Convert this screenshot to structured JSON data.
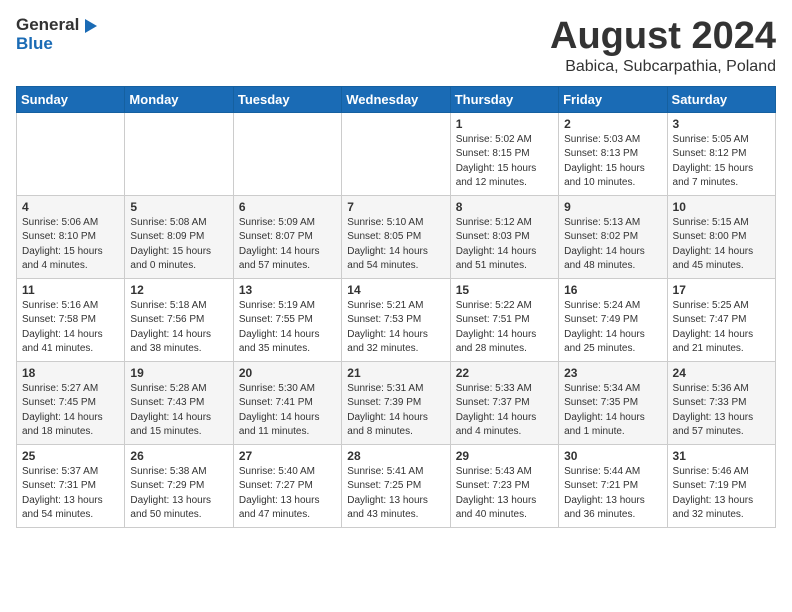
{
  "header": {
    "logo_general": "General",
    "logo_blue": "Blue",
    "main_title": "August 2024",
    "subtitle": "Babica, Subcarpathia, Poland"
  },
  "calendar": {
    "days_of_week": [
      "Sunday",
      "Monday",
      "Tuesday",
      "Wednesday",
      "Thursday",
      "Friday",
      "Saturday"
    ],
    "weeks": [
      [
        {
          "day": "",
          "info": ""
        },
        {
          "day": "",
          "info": ""
        },
        {
          "day": "",
          "info": ""
        },
        {
          "day": "",
          "info": ""
        },
        {
          "day": "1",
          "info": "Sunrise: 5:02 AM\nSunset: 8:15 PM\nDaylight: 15 hours\nand 12 minutes."
        },
        {
          "day": "2",
          "info": "Sunrise: 5:03 AM\nSunset: 8:13 PM\nDaylight: 15 hours\nand 10 minutes."
        },
        {
          "day": "3",
          "info": "Sunrise: 5:05 AM\nSunset: 8:12 PM\nDaylight: 15 hours\nand 7 minutes."
        }
      ],
      [
        {
          "day": "4",
          "info": "Sunrise: 5:06 AM\nSunset: 8:10 PM\nDaylight: 15 hours\nand 4 minutes."
        },
        {
          "day": "5",
          "info": "Sunrise: 5:08 AM\nSunset: 8:09 PM\nDaylight: 15 hours\nand 0 minutes."
        },
        {
          "day": "6",
          "info": "Sunrise: 5:09 AM\nSunset: 8:07 PM\nDaylight: 14 hours\nand 57 minutes."
        },
        {
          "day": "7",
          "info": "Sunrise: 5:10 AM\nSunset: 8:05 PM\nDaylight: 14 hours\nand 54 minutes."
        },
        {
          "day": "8",
          "info": "Sunrise: 5:12 AM\nSunset: 8:03 PM\nDaylight: 14 hours\nand 51 minutes."
        },
        {
          "day": "9",
          "info": "Sunrise: 5:13 AM\nSunset: 8:02 PM\nDaylight: 14 hours\nand 48 minutes."
        },
        {
          "day": "10",
          "info": "Sunrise: 5:15 AM\nSunset: 8:00 PM\nDaylight: 14 hours\nand 45 minutes."
        }
      ],
      [
        {
          "day": "11",
          "info": "Sunrise: 5:16 AM\nSunset: 7:58 PM\nDaylight: 14 hours\nand 41 minutes."
        },
        {
          "day": "12",
          "info": "Sunrise: 5:18 AM\nSunset: 7:56 PM\nDaylight: 14 hours\nand 38 minutes."
        },
        {
          "day": "13",
          "info": "Sunrise: 5:19 AM\nSunset: 7:55 PM\nDaylight: 14 hours\nand 35 minutes."
        },
        {
          "day": "14",
          "info": "Sunrise: 5:21 AM\nSunset: 7:53 PM\nDaylight: 14 hours\nand 32 minutes."
        },
        {
          "day": "15",
          "info": "Sunrise: 5:22 AM\nSunset: 7:51 PM\nDaylight: 14 hours\nand 28 minutes."
        },
        {
          "day": "16",
          "info": "Sunrise: 5:24 AM\nSunset: 7:49 PM\nDaylight: 14 hours\nand 25 minutes."
        },
        {
          "day": "17",
          "info": "Sunrise: 5:25 AM\nSunset: 7:47 PM\nDaylight: 14 hours\nand 21 minutes."
        }
      ],
      [
        {
          "day": "18",
          "info": "Sunrise: 5:27 AM\nSunset: 7:45 PM\nDaylight: 14 hours\nand 18 minutes."
        },
        {
          "day": "19",
          "info": "Sunrise: 5:28 AM\nSunset: 7:43 PM\nDaylight: 14 hours\nand 15 minutes."
        },
        {
          "day": "20",
          "info": "Sunrise: 5:30 AM\nSunset: 7:41 PM\nDaylight: 14 hours\nand 11 minutes."
        },
        {
          "day": "21",
          "info": "Sunrise: 5:31 AM\nSunset: 7:39 PM\nDaylight: 14 hours\nand 8 minutes."
        },
        {
          "day": "22",
          "info": "Sunrise: 5:33 AM\nSunset: 7:37 PM\nDaylight: 14 hours\nand 4 minutes."
        },
        {
          "day": "23",
          "info": "Sunrise: 5:34 AM\nSunset: 7:35 PM\nDaylight: 14 hours\nand 1 minute."
        },
        {
          "day": "24",
          "info": "Sunrise: 5:36 AM\nSunset: 7:33 PM\nDaylight: 13 hours\nand 57 minutes."
        }
      ],
      [
        {
          "day": "25",
          "info": "Sunrise: 5:37 AM\nSunset: 7:31 PM\nDaylight: 13 hours\nand 54 minutes."
        },
        {
          "day": "26",
          "info": "Sunrise: 5:38 AM\nSunset: 7:29 PM\nDaylight: 13 hours\nand 50 minutes."
        },
        {
          "day": "27",
          "info": "Sunrise: 5:40 AM\nSunset: 7:27 PM\nDaylight: 13 hours\nand 47 minutes."
        },
        {
          "day": "28",
          "info": "Sunrise: 5:41 AM\nSunset: 7:25 PM\nDaylight: 13 hours\nand 43 minutes."
        },
        {
          "day": "29",
          "info": "Sunrise: 5:43 AM\nSunset: 7:23 PM\nDaylight: 13 hours\nand 40 minutes."
        },
        {
          "day": "30",
          "info": "Sunrise: 5:44 AM\nSunset: 7:21 PM\nDaylight: 13 hours\nand 36 minutes."
        },
        {
          "day": "31",
          "info": "Sunrise: 5:46 AM\nSunset: 7:19 PM\nDaylight: 13 hours\nand 32 minutes."
        }
      ]
    ]
  }
}
